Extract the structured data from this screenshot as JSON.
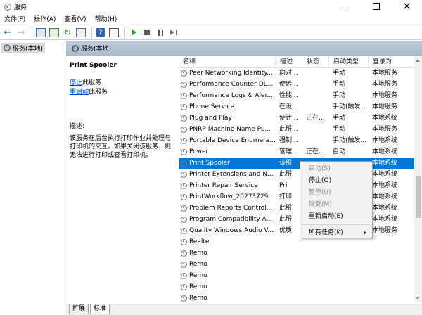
{
  "window": {
    "title": "服务"
  },
  "menu": [
    "文件(F)",
    "操作(A)",
    "查看(V)",
    "帮助(H)"
  ],
  "toolbar": {
    "icons": [
      "back-arrow-icon",
      "forward-arrow-icon",
      "show-console-tree-icon",
      "console-list-icon",
      "refresh-icon",
      "export-list-icon",
      "help-icon",
      "properties-icon",
      "start-service-icon",
      "stop-service-icon",
      "pause-service-icon",
      "restart-service-icon"
    ]
  },
  "tree": {
    "root": "服务(本地)"
  },
  "panel_header": "服务(本地)",
  "details": {
    "service_name": "Print Spooler",
    "stop_link": "停止",
    "stop_suffix": "此服务",
    "restart_link": "重启动",
    "restart_suffix": "此服务",
    "desc_title": "描述:",
    "desc": "该服务在后台执行打印作业并处理与打印机的交互。如果关闭该服务，则无法进行打印或查看打印机。"
  },
  "table": {
    "headers": {
      "name": "名称",
      "desc": "描述",
      "status": "状态",
      "startup": "启动类型",
      "logon": "登录为"
    },
    "rows": [
      {
        "name": "Peer Networking Identity...",
        "desc": "向对...",
        "status": "",
        "startup": "手动",
        "logon": "本地服务"
      },
      {
        "name": "Performance Counter DL...",
        "desc": "使远...",
        "status": "",
        "startup": "手动",
        "logon": "本地服务"
      },
      {
        "name": "Performance Logs & Aler...",
        "desc": "性能...",
        "status": "",
        "startup": "手动",
        "logon": "本地服务"
      },
      {
        "name": "Phone Service",
        "desc": "在设...",
        "status": "",
        "startup": "手动(触发...",
        "logon": "本地服务"
      },
      {
        "name": "Plug and Play",
        "desc": "使计...",
        "status": "正在...",
        "startup": "手动",
        "logon": "本地系统"
      },
      {
        "name": "PNRP Machine Name Pu...",
        "desc": "此服...",
        "status": "",
        "startup": "手动",
        "logon": "本地服务"
      },
      {
        "name": "Portable Device Enumera...",
        "desc": "强制...",
        "status": "",
        "startup": "手动(触发...",
        "logon": "本地系统"
      },
      {
        "name": "Power",
        "desc": "管理...",
        "status": "正在...",
        "startup": "自动",
        "logon": "本地系统"
      },
      {
        "name": "Print Spooler",
        "desc": "该服",
        "status": "",
        "startup": "",
        "logon": "本地系统"
      },
      {
        "name": "Printer Extensions and N...",
        "desc": "此服",
        "status": "",
        "startup": "",
        "logon": "本地系统"
      },
      {
        "name": "Printer Repair Service",
        "desc": "Pri",
        "status": "",
        "startup": "",
        "logon": "本地系统"
      },
      {
        "name": "PrintWorkflow_20273729",
        "desc": "打印",
        "status": "",
        "startup": "",
        "logon": "本地系统"
      },
      {
        "name": "Problem Reports Control...",
        "desc": "此服",
        "status": "",
        "startup": "",
        "logon": "本地系统"
      },
      {
        "name": "Program Compatibility A...",
        "desc": "此服",
        "status": "",
        "startup": "",
        "logon": "本地系统"
      },
      {
        "name": "Quality Windows Audio V...",
        "desc": "优质",
        "status": "",
        "startup": "",
        "logon": "本地服务"
      },
      {
        "name": "Realte",
        "desc": "",
        "status": "",
        "startup": "",
        "logon": ""
      },
      {
        "name": "Remo",
        "desc": "",
        "status": "",
        "startup": "",
        "logon": ""
      },
      {
        "name": "Remo",
        "desc": "",
        "status": "",
        "startup": "",
        "logon": ""
      },
      {
        "name": "Remo",
        "desc": "",
        "status": "",
        "startup": "",
        "logon": ""
      },
      {
        "name": "Remo",
        "desc": "",
        "status": "",
        "startup": "",
        "logon": ""
      },
      {
        "name": "Remo",
        "desc": "",
        "status": "",
        "startup": "",
        "logon": ""
      }
    ],
    "selected_index": 8
  },
  "context_menu": {
    "items": [
      {
        "label": "启动(S)",
        "disabled": true
      },
      {
        "label": "停止(O)",
        "disabled": false
      },
      {
        "label": "暂停(U)",
        "disabled": true
      },
      {
        "label": "恢复(M)",
        "disabled": true
      },
      {
        "label": "重新启动(E)",
        "disabled": false
      },
      {
        "separator": true
      },
      {
        "label": "所有任务(K)",
        "disabled": false,
        "submenu": true
      }
    ]
  },
  "tabs": [
    "扩展",
    "标准"
  ]
}
